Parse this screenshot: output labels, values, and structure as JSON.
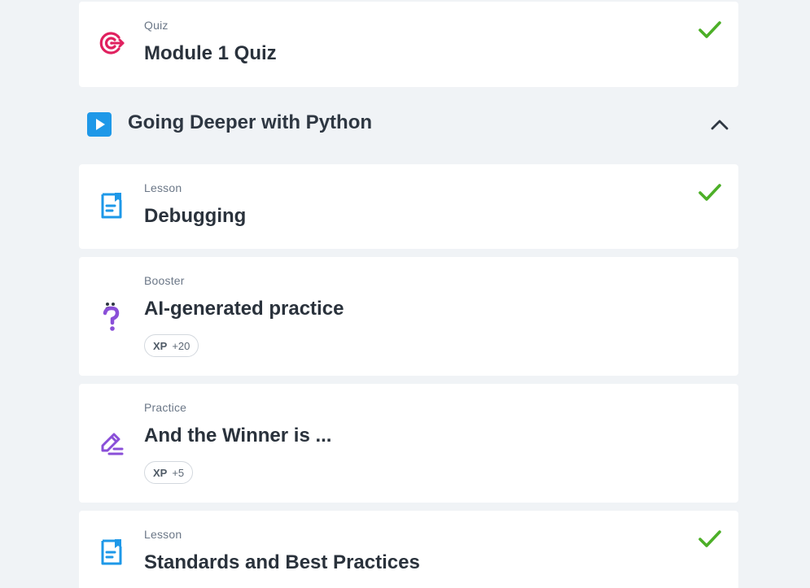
{
  "items": [
    {
      "kind": "Quiz",
      "title": "Module 1 Quiz",
      "icon": "target-icon",
      "completed": true
    },
    {
      "kind": "Lesson",
      "title": "Debugging",
      "icon": "lesson-document-icon",
      "completed": true
    },
    {
      "kind": "Booster",
      "title": "AI-generated practice",
      "icon": "question-mark-icon",
      "xp_label": "XP",
      "xp_value": "+20",
      "completed": false
    },
    {
      "kind": "Practice",
      "title": "And the Winner is ...",
      "icon": "pencil-edit-icon",
      "xp_label": "XP",
      "xp_value": "+5",
      "completed": false
    },
    {
      "kind": "Lesson",
      "title": "Standards and Best Practices",
      "icon": "lesson-document-icon",
      "completed": true
    }
  ],
  "section": {
    "title": "Going Deeper with Python",
    "icon": "play-icon",
    "toggle_icon": "chevron-up-icon",
    "expanded": true
  },
  "colors": {
    "page_bg": "#f0f3f6",
    "check": "#4caf27",
    "quiz_icon": "#e0215f",
    "lesson_icon": "#1e98e8",
    "practice_icon": "#8a4fd8",
    "section_play": "#1e98e8"
  }
}
